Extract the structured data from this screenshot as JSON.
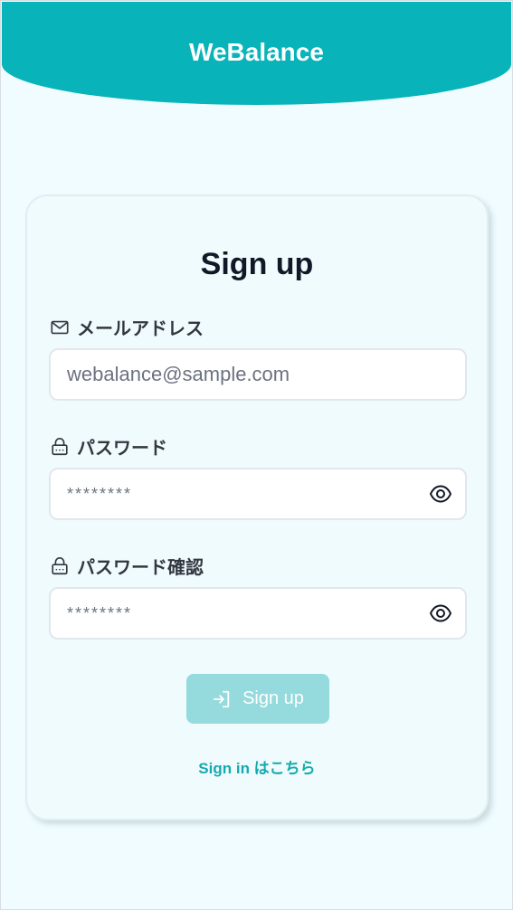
{
  "header": {
    "app_name": "WeBalance"
  },
  "form": {
    "title": "Sign up",
    "email": {
      "label": "メールアドレス",
      "placeholder": "webalance@sample.com",
      "icon": "mail-icon"
    },
    "password": {
      "label": "パスワード",
      "placeholder": "********",
      "icon": "lock-icon"
    },
    "password_confirm": {
      "label": "パスワード確認",
      "placeholder": "********",
      "icon": "lock-icon"
    },
    "submit_label": "Sign up",
    "signin_link": "Sign in はこちら"
  },
  "colors": {
    "brand": "#08b4b9",
    "button_disabled": "#95dadd",
    "background": "#f0fcff"
  }
}
